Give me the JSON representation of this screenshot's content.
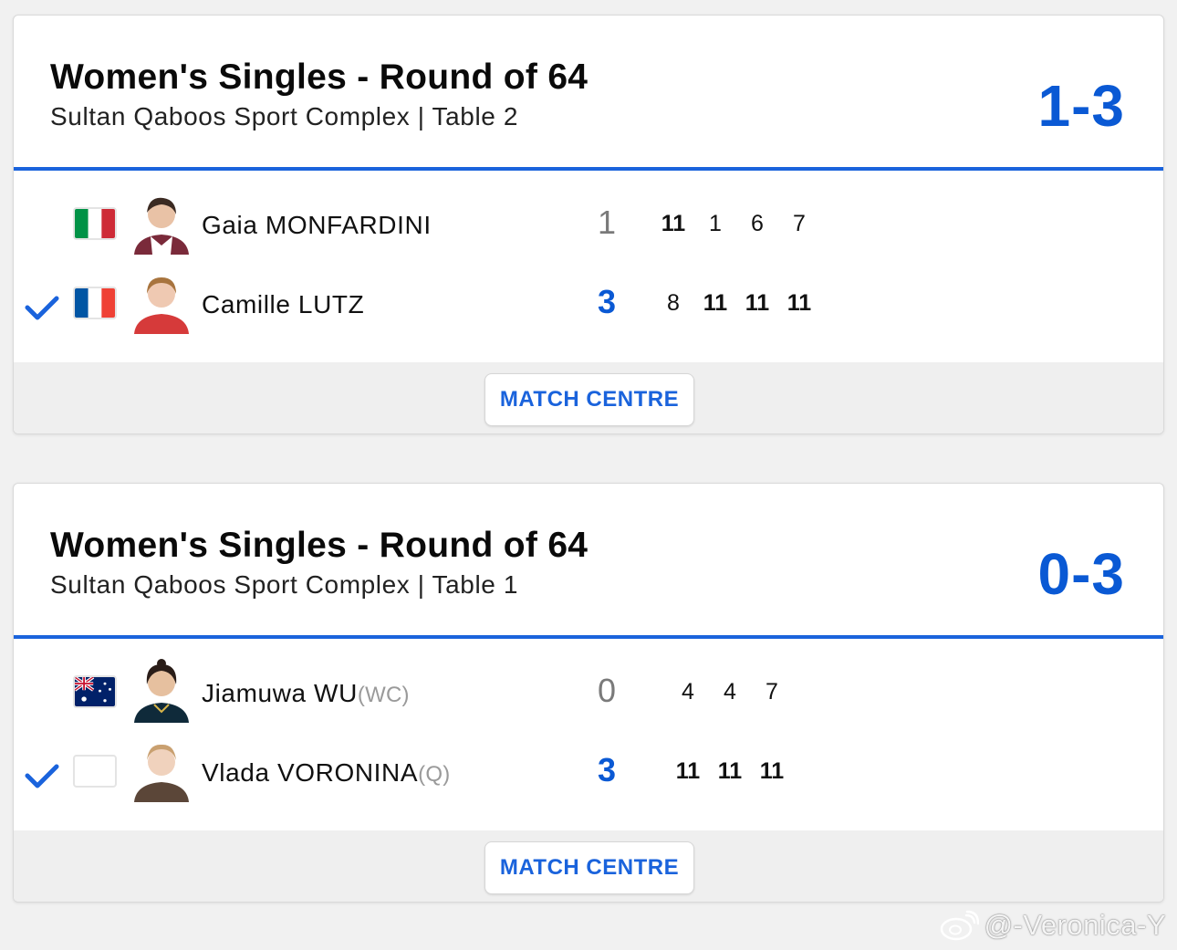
{
  "matches": [
    {
      "title": "Women's Singles - Round of 64",
      "venue": "Sultan Qaboos Sport Complex | Table 2",
      "score": "1-3",
      "players": [
        {
          "name": "Gaia MONFARDINI",
          "tag": "",
          "flag": "italy-flag",
          "total": "1",
          "winner": false,
          "games": [
            "11",
            "1",
            "6",
            "7"
          ],
          "games_bold": [
            true,
            false,
            false,
            false
          ]
        },
        {
          "name": "Camille LUTZ",
          "tag": "",
          "flag": "france-flag",
          "total": "3",
          "winner": true,
          "games": [
            "8",
            "11",
            "11",
            "11"
          ],
          "games_bold": [
            false,
            true,
            true,
            true
          ]
        }
      ],
      "button": "MATCH CENTRE"
    },
    {
      "title": "Women's Singles - Round of 64",
      "venue": "Sultan Qaboos Sport Complex | Table 1",
      "score": "0-3",
      "players": [
        {
          "name": "Jiamuwa WU",
          "tag": "(WC)",
          "flag": "australia-flag",
          "total": "0",
          "winner": false,
          "games": [
            "4",
            "4",
            "7"
          ],
          "games_bold": [
            false,
            false,
            false
          ]
        },
        {
          "name": "Vlada VORONINA",
          "tag": "(Q)",
          "flag": "blank-flag",
          "total": "3",
          "winner": true,
          "games": [
            "11",
            "11",
            "11"
          ],
          "games_bold": [
            true,
            true,
            true
          ]
        }
      ],
      "button": "MATCH CENTRE"
    }
  ],
  "watermark": "@-Veronica-Y",
  "colors": {
    "accent": "#1a63dc",
    "score": "#0a59d4",
    "footer": "#efefef"
  }
}
